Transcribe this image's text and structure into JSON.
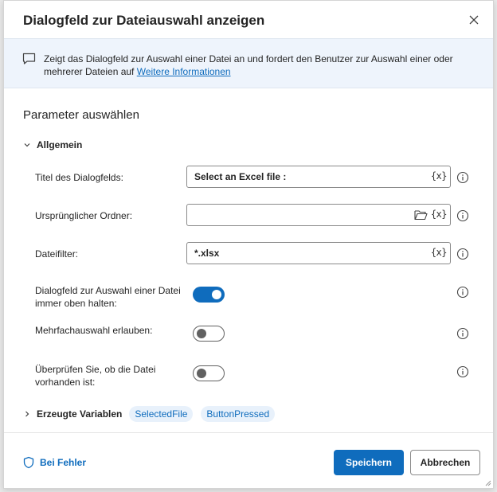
{
  "dialog": {
    "title": "Dialogfeld zur Dateiauswahl anzeigen"
  },
  "info": {
    "text": "Zeigt das Dialogfeld zur Auswahl einer Datei an und fordert den Benutzer zur Auswahl einer oder mehrerer Dateien auf",
    "link": "Weitere Informationen"
  },
  "params": {
    "section_title": "Parameter auswählen",
    "group_label": "Allgemein"
  },
  "fields": {
    "title": {
      "label": "Titel des Dialogfelds:",
      "value": "Select an Excel file :"
    },
    "folder": {
      "label": "Ursprünglicher Ordner:",
      "value": ""
    },
    "filter": {
      "label": "Dateifilter:",
      "value": "*.xlsx"
    },
    "var_button": "{x}"
  },
  "toggles": {
    "keep_on_top": {
      "label_line1": "Dialogfeld zur Auswahl einer Datei",
      "label_line2": "immer oben halten:",
      "on": true
    },
    "multi_select": {
      "label": "Mehrfachauswahl erlauben:",
      "on": false
    },
    "check_exists": {
      "label_line1": "Überprüfen Sie, ob die Datei",
      "label_line2": "vorhanden ist:",
      "on": false
    }
  },
  "variables": {
    "label": "Erzeugte Variablen",
    "items": [
      "SelectedFile",
      "ButtonPressed"
    ]
  },
  "footer": {
    "on_error": "Bei Fehler",
    "save": "Speichern",
    "cancel": "Abbrechen"
  },
  "colors": {
    "accent": "#0f6cbd",
    "banner_bg": "#eef4fc",
    "chip_bg": "#e8f1fb"
  }
}
